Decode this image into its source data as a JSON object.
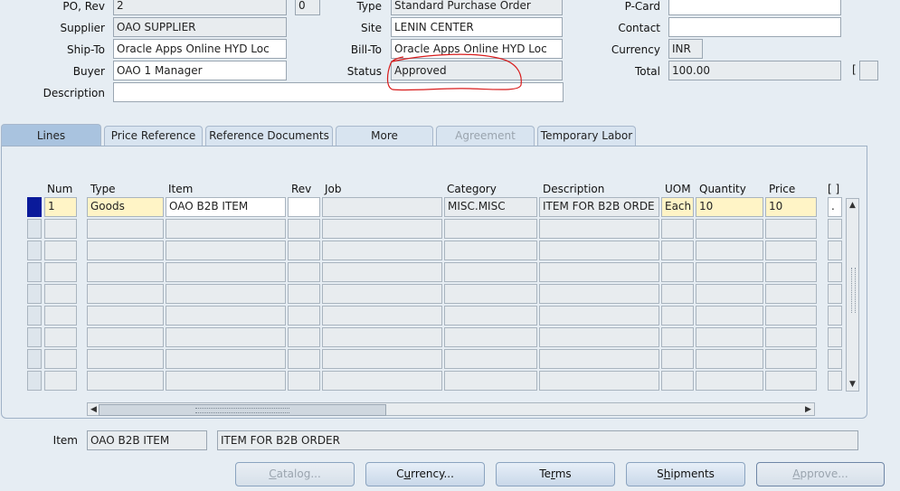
{
  "header": {
    "po_rev_label": "PO, Rev",
    "po_value": "2",
    "rev_value": "0",
    "type_label": "Type",
    "type_value": "Standard Purchase Order",
    "pcard_label": "P-Card",
    "supplier_label": "Supplier",
    "supplier_value": "OAO SUPPLIER",
    "site_label": "Site",
    "site_value": "LENIN CENTER",
    "contact_label": "Contact",
    "shipto_label": "Ship-To",
    "shipto_value": "Oracle Apps Online HYD Loc",
    "billto_label": "Bill-To",
    "billto_value": "Oracle Apps Online HYD Loc",
    "currency_label": "Currency",
    "currency_value": "INR",
    "buyer_label": "Buyer",
    "buyer_value": "OAO 1 Manager",
    "status_label": "Status",
    "status_value": "Approved",
    "total_label": "Total",
    "total_value": "100.00",
    "description_label": "Description",
    "flex_bracket": "[ ]"
  },
  "tabs": [
    {
      "label": "Lines",
      "state": "active"
    },
    {
      "label": "Price Reference",
      "state": "normal"
    },
    {
      "label": "Reference Documents",
      "state": "normal"
    },
    {
      "label": "More",
      "state": "normal"
    },
    {
      "label": "Agreement",
      "state": "disabled"
    },
    {
      "label": "Temporary Labor",
      "state": "normal"
    }
  ],
  "lines": {
    "columns": [
      "Num",
      "Type",
      "Item",
      "Rev",
      "Job",
      "Category",
      "Description",
      "UOM",
      "Quantity",
      "Price",
      "[ ]"
    ],
    "rows": [
      {
        "num": "1",
        "type": "Goods",
        "item": "OAO B2B ITEM",
        "rev": "",
        "job": "",
        "category": "MISC.MISC",
        "description": "ITEM FOR B2B ORDE",
        "uom": "Each",
        "quantity": "10",
        "price": "10",
        "flex": "."
      }
    ]
  },
  "footer": {
    "item_label": "Item",
    "item_value": "OAO B2B ITEM",
    "item_description": "ITEM FOR B2B ORDER"
  },
  "buttons": {
    "catalog": {
      "label": "Catalog...",
      "mnemonic_index": 0,
      "disabled": true
    },
    "currency": {
      "label": "Currency...",
      "mnemonic_index": 1,
      "disabled": false
    },
    "terms": {
      "label": "Terms",
      "mnemonic_index": 2,
      "disabled": false
    },
    "shipments": {
      "label": "Shipments",
      "mnemonic_index": 1,
      "disabled": false
    },
    "approve": {
      "label": "Approve...",
      "mnemonic_index": 0,
      "disabled": true
    }
  },
  "colors": {
    "status_annotation": "#d81b1b",
    "current_record": "#0a1a9a",
    "required_field": "#fff4c6"
  }
}
